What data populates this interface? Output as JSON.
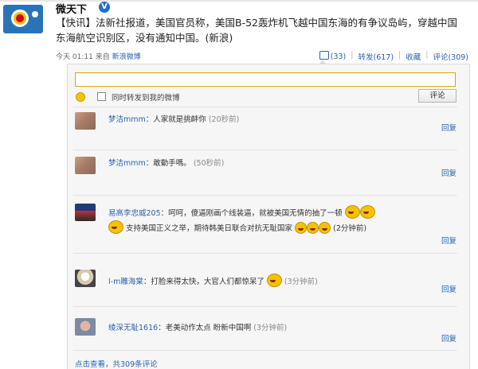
{
  "post": {
    "author": "微天下",
    "verified_badge": "V",
    "text": "【快讯】法新社报道，美国官员称，美国B-52轰炸机飞越中国东海的有争议岛屿，穿越中国东海航空识别区，没有通知中国。(新浪)",
    "time": "今天 01:11",
    "source_prefix": "来自",
    "source": "新浪微博",
    "like": "(33)",
    "repost": "转发(617)",
    "collect": "收藏",
    "comment": "评论(309)",
    "sep": "|"
  },
  "composer": {
    "also_repost_label": "同时转发到我的微博",
    "submit_label": "评论"
  },
  "comments": [
    {
      "user": "梦洁mmm",
      "text": "：人家就是挑衅你",
      "time": "(20秒前)",
      "reply": "回复"
    },
    {
      "user": "梦洁mmm",
      "text": "：敢動手嗎。",
      "time": "(50秒前)",
      "reply": "回复"
    },
    {
      "user": "易高李忠威205",
      "text": "：呵呵，傻逼刚画个线装逼，就被美国无情的抽了一顿",
      "text2": "支持美国正义之举，期待韩美日联合对抗无耻国家",
      "time": "(2分钟前)",
      "reply": "回复"
    },
    {
      "user": "l-m雕海棠",
      "text": "：打脸来得太快，大官人们都惊呆了",
      "time": "(3分钟前)",
      "reply": "回复"
    },
    {
      "user": "绫深无耻1616",
      "text": "：老美动作太点 盼新中国啊",
      "time": "(3分钟前)",
      "reply": "回复"
    }
  ],
  "footer": {
    "view_all": "点击查看，共309条评论"
  }
}
